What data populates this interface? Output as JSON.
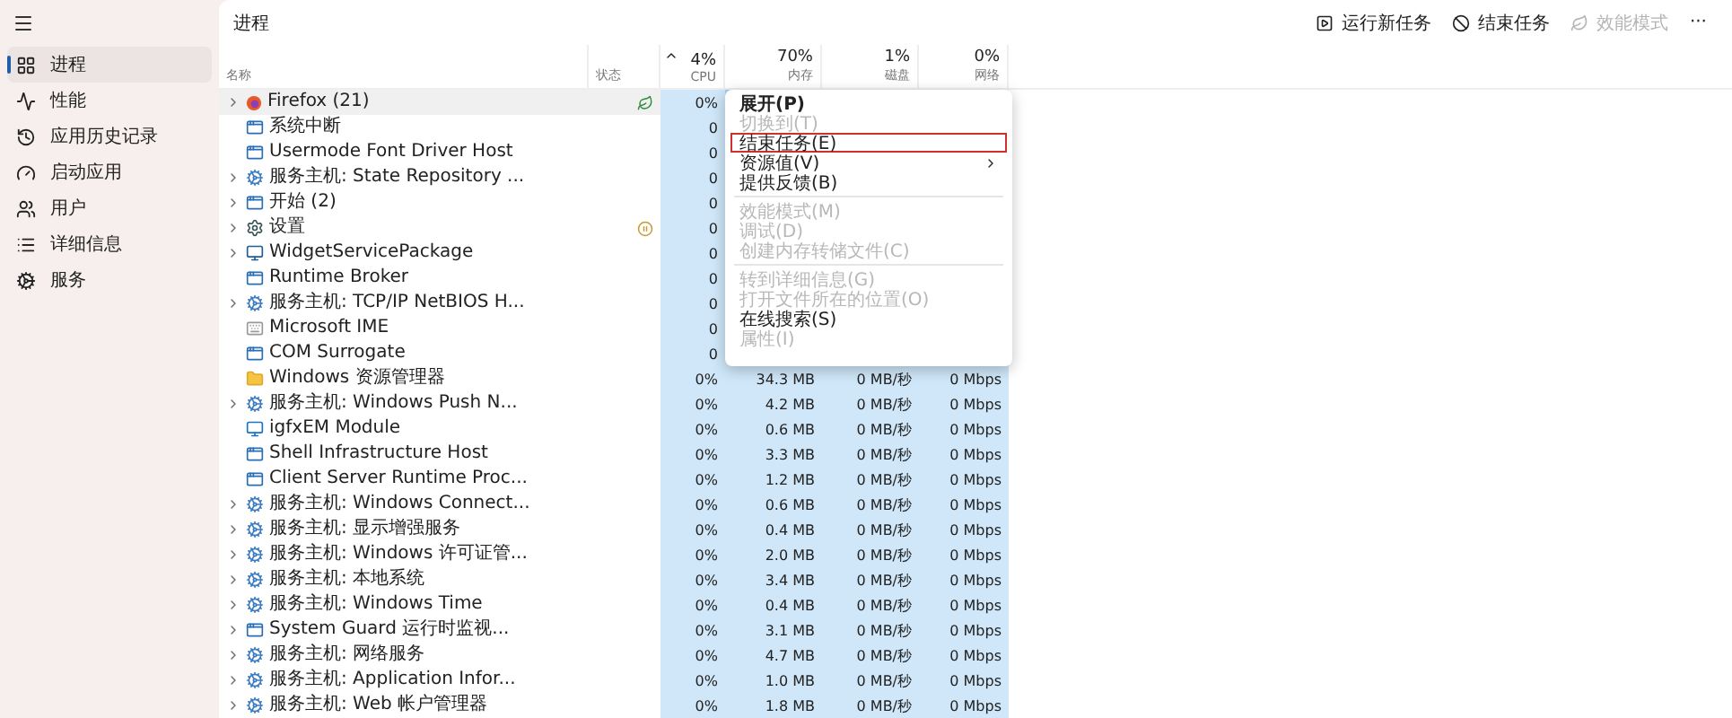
{
  "sidebar": {
    "items": [
      {
        "label": "进程",
        "selected": true
      },
      {
        "label": "性能",
        "selected": false
      },
      {
        "label": "应用历史记录",
        "selected": false
      },
      {
        "label": "启动应用",
        "selected": false
      },
      {
        "label": "用户",
        "selected": false
      },
      {
        "label": "详细信息",
        "selected": false
      },
      {
        "label": "服务",
        "selected": false
      }
    ]
  },
  "page_title": "进程",
  "toolbar": [
    {
      "label": "运行新任务",
      "disabled": false
    },
    {
      "label": "结束任务",
      "disabled": false
    },
    {
      "label": "效能模式",
      "disabled": true
    },
    {
      "label": "···",
      "disabled": false
    }
  ],
  "table": {
    "columns": [
      {
        "label": "名称"
      },
      {
        "label": "状态"
      },
      {
        "usage": "4%",
        "label": "CPU"
      },
      {
        "usage": "70%",
        "label": "内存"
      },
      {
        "usage": "1%",
        "label": "磁盘"
      },
      {
        "usage": "0%",
        "label": "网络"
      }
    ],
    "rows": [
      {
        "name": "Firefox (21)",
        "kind": "browser",
        "expandable": true,
        "eco_mode": true,
        "suspended": false,
        "selected": true,
        "cpu": "0%"
      },
      {
        "name": "系统中断",
        "kind": "window",
        "expandable": false,
        "eco_mode": false,
        "suspended": false,
        "selected": false,
        "cpu": "0"
      },
      {
        "name": "Usermode Font Driver Host",
        "kind": "window",
        "expandable": false,
        "eco_mode": false,
        "suspended": false,
        "selected": false,
        "cpu": "0"
      },
      {
        "name": "服务主机: State Repository ...",
        "kind": "service",
        "expandable": true,
        "eco_mode": false,
        "suspended": false,
        "selected": false,
        "cpu": "0"
      },
      {
        "name": "开始 (2)",
        "kind": "window",
        "expandable": true,
        "eco_mode": false,
        "suspended": false,
        "selected": false,
        "cpu": "0"
      },
      {
        "name": "设置",
        "kind": "settings",
        "expandable": true,
        "eco_mode": false,
        "suspended": true,
        "selected": false,
        "cpu": "0"
      },
      {
        "name": "WidgetServicePackage",
        "kind": "widget",
        "expandable": true,
        "eco_mode": false,
        "suspended": false,
        "selected": false,
        "cpu": "0"
      },
      {
        "name": "Runtime Broker",
        "kind": "window",
        "expandable": false,
        "eco_mode": false,
        "suspended": false,
        "selected": false,
        "cpu": "0"
      },
      {
        "name": "服务主机: TCP/IP NetBIOS H...",
        "kind": "service",
        "expandable": true,
        "eco_mode": false,
        "suspended": false,
        "selected": false,
        "cpu": "0"
      },
      {
        "name": "Microsoft IME",
        "kind": "ime",
        "expandable": false,
        "eco_mode": false,
        "suspended": false,
        "selected": false,
        "cpu": "0"
      },
      {
        "name": "COM Surrogate",
        "kind": "window",
        "expandable": false,
        "eco_mode": false,
        "suspended": false,
        "selected": false,
        "cpu": "0"
      },
      {
        "name": "Windows 资源管理器",
        "kind": "folder",
        "expandable": false,
        "eco_mode": false,
        "suspended": false,
        "selected": false,
        "cpu": "0%",
        "memory": "34.3 MB",
        "disk": "0 MB/秒",
        "network": "0 Mbps"
      },
      {
        "name": "服务主机: Windows Push N...",
        "kind": "service",
        "expandable": true,
        "eco_mode": false,
        "suspended": false,
        "selected": false,
        "cpu": "0%",
        "memory": "4.2 MB",
        "disk": "0 MB/秒",
        "network": "0 Mbps"
      },
      {
        "name": "igfxEM Module",
        "kind": "module",
        "expandable": false,
        "eco_mode": false,
        "suspended": false,
        "selected": false,
        "cpu": "0%",
        "memory": "0.6 MB",
        "disk": "0 MB/秒",
        "network": "0 Mbps"
      },
      {
        "name": "Shell Infrastructure Host",
        "kind": "window",
        "expandable": false,
        "eco_mode": false,
        "suspended": false,
        "selected": false,
        "cpu": "0%",
        "memory": "3.3 MB",
        "disk": "0 MB/秒",
        "network": "0 Mbps"
      },
      {
        "name": "Client Server Runtime Proc...",
        "kind": "window",
        "expandable": false,
        "eco_mode": false,
        "suspended": false,
        "selected": false,
        "cpu": "0%",
        "memory": "1.2 MB",
        "disk": "0 MB/秒",
        "network": "0 Mbps"
      },
      {
        "name": "服务主机: Windows Connect...",
        "kind": "service",
        "expandable": true,
        "eco_mode": false,
        "suspended": false,
        "selected": false,
        "cpu": "0%",
        "memory": "0.6 MB",
        "disk": "0 MB/秒",
        "network": "0 Mbps"
      },
      {
        "name": "服务主机: 显示增强服务",
        "kind": "service",
        "expandable": true,
        "eco_mode": false,
        "suspended": false,
        "selected": false,
        "cpu": "0%",
        "memory": "0.4 MB",
        "disk": "0 MB/秒",
        "network": "0 Mbps"
      },
      {
        "name": "服务主机: Windows 许可证管...",
        "kind": "service",
        "expandable": true,
        "eco_mode": false,
        "suspended": false,
        "selected": false,
        "cpu": "0%",
        "memory": "2.0 MB",
        "disk": "0 MB/秒",
        "network": "0 Mbps"
      },
      {
        "name": "服务主机: 本地系统",
        "kind": "service",
        "expandable": true,
        "eco_mode": false,
        "suspended": false,
        "selected": false,
        "cpu": "0%",
        "memory": "3.4 MB",
        "disk": "0 MB/秒",
        "network": "0 Mbps"
      },
      {
        "name": "服务主机: Windows Time",
        "kind": "service",
        "expandable": true,
        "eco_mode": false,
        "suspended": false,
        "selected": false,
        "cpu": "0%",
        "memory": "0.4 MB",
        "disk": "0 MB/秒",
        "network": "0 Mbps"
      },
      {
        "name": "System Guard 运行时监视...",
        "kind": "window",
        "expandable": true,
        "eco_mode": false,
        "suspended": false,
        "selected": false,
        "cpu": "0%",
        "memory": "3.1 MB",
        "disk": "0 MB/秒",
        "network": "0 Mbps"
      },
      {
        "name": "服务主机: 网络服务",
        "kind": "service",
        "expandable": true,
        "eco_mode": false,
        "suspended": false,
        "selected": false,
        "cpu": "0%",
        "memory": "4.7 MB",
        "disk": "0 MB/秒",
        "network": "0 Mbps"
      },
      {
        "name": "服务主机: Application Infor...",
        "kind": "service",
        "expandable": true,
        "eco_mode": false,
        "suspended": false,
        "selected": false,
        "cpu": "0%",
        "memory": "1.0 MB",
        "disk": "0 MB/秒",
        "network": "0 Mbps"
      },
      {
        "name": "服务主机: Web 帐户管理器",
        "kind": "service",
        "expandable": true,
        "eco_mode": false,
        "suspended": false,
        "selected": false,
        "cpu": "0%",
        "memory": "1.8 MB",
        "disk": "0 MB/秒",
        "network": "0 Mbps"
      }
    ]
  },
  "context_menu": {
    "items": [
      {
        "kind": "item",
        "label": "展开(P)",
        "disabled": false,
        "bold": true,
        "highlighted": false,
        "submenu": false
      },
      {
        "kind": "item",
        "label": "切换到(T)",
        "disabled": true,
        "bold": false,
        "highlighted": false,
        "submenu": false
      },
      {
        "kind": "item",
        "label": "结束任务(E)",
        "disabled": false,
        "bold": false,
        "highlighted": true,
        "submenu": false
      },
      {
        "kind": "item",
        "label": "资源值(V)",
        "disabled": false,
        "bold": false,
        "highlighted": false,
        "submenu": true
      },
      {
        "kind": "item",
        "label": "提供反馈(B)",
        "disabled": false,
        "bold": false,
        "highlighted": false,
        "submenu": false
      },
      {
        "kind": "separator"
      },
      {
        "kind": "item",
        "label": "效能模式(M)",
        "disabled": true,
        "bold": false,
        "highlighted": false,
        "submenu": false
      },
      {
        "kind": "item",
        "label": "调试(D)",
        "disabled": true,
        "bold": false,
        "highlighted": false,
        "submenu": false
      },
      {
        "kind": "item",
        "label": "创建内存转储文件(C)",
        "disabled": true,
        "bold": false,
        "highlighted": false,
        "submenu": false
      },
      {
        "kind": "separator"
      },
      {
        "kind": "item",
        "label": "转到详细信息(G)",
        "disabled": true,
        "bold": false,
        "highlighted": false,
        "submenu": false
      },
      {
        "kind": "item",
        "label": "打开文件所在的位置(O)",
        "disabled": true,
        "bold": false,
        "highlighted": false,
        "submenu": false
      },
      {
        "kind": "item",
        "label": "在线搜索(S)",
        "disabled": false,
        "bold": false,
        "highlighted": false,
        "submenu": false
      },
      {
        "kind": "item",
        "label": "属性(I)",
        "disabled": true,
        "bold": false,
        "highlighted": false,
        "submenu": false
      }
    ]
  }
}
